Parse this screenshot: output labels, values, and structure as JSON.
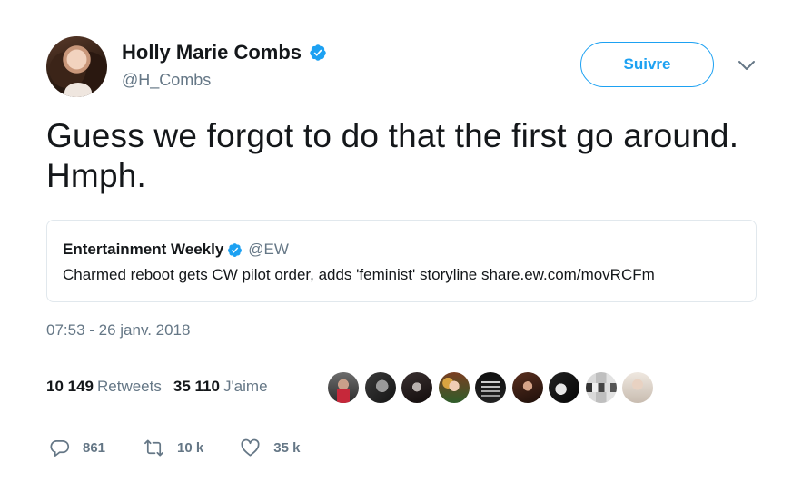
{
  "author": {
    "name": "Holly Marie Combs",
    "handle": "@H_Combs",
    "verified": true
  },
  "follow_button": {
    "label": "Suivre"
  },
  "tweet": {
    "text": "Guess we forgot to do that the first go around. Hmph."
  },
  "quoted_tweet": {
    "name": "Entertainment Weekly",
    "handle": "@EW",
    "verified": true,
    "text": "Charmed reboot gets CW pilot order, adds 'feminist' storyline share.ew.com/movRCFm"
  },
  "timestamp": "07:53 - 26 janv. 2018",
  "stats": {
    "retweets_count": "10 149",
    "retweets_label": "Retweets",
    "likes_count": "35 110",
    "likes_label": "J'aime"
  },
  "actions": {
    "replies": "861",
    "retweets": "10 k",
    "likes": "35 k"
  },
  "colors": {
    "accent": "#1da1f2",
    "text": "#14171a",
    "muted": "#657786",
    "border": "#e1e8ed"
  }
}
